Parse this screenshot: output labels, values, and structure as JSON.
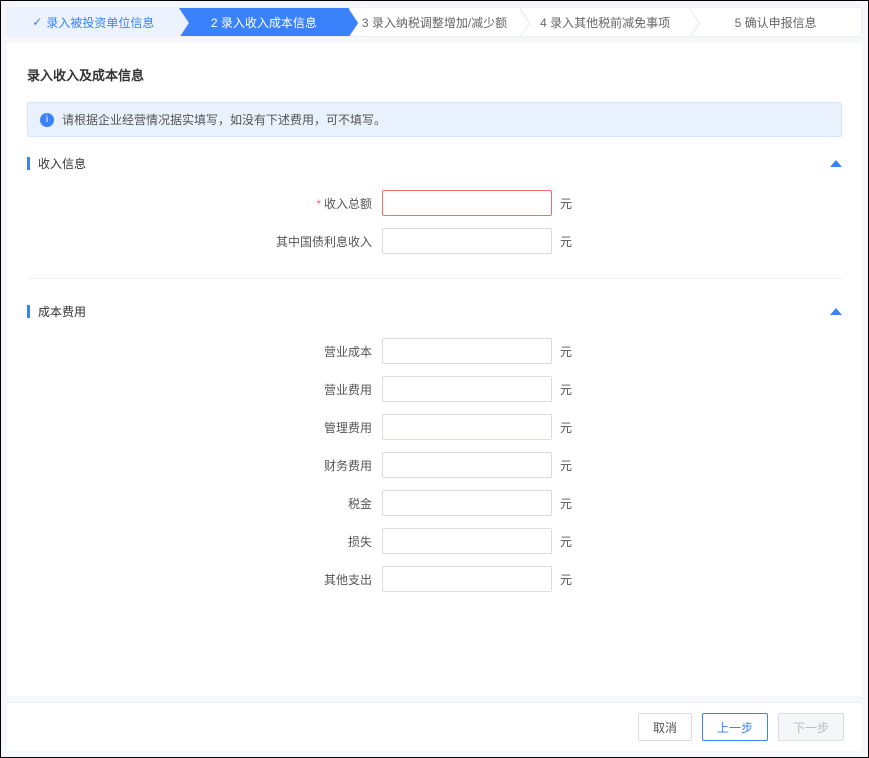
{
  "stepper": [
    {
      "label": "录入被投资单位信息",
      "state": "done"
    },
    {
      "label": "2 录入收入成本信息",
      "state": "active"
    },
    {
      "label": "3 录入纳税调整增加/减少额",
      "state": ""
    },
    {
      "label": "4 录入其他税前减免事项",
      "state": ""
    },
    {
      "label": "5 确认申报信息",
      "state": ""
    }
  ],
  "page": {
    "title": "录入收入及成本信息",
    "alert": "请根据企业经营情况据实填写，如没有下述费用，可不填写。"
  },
  "sections": {
    "income": {
      "title": "收入信息",
      "fields": {
        "total_income": {
          "label": "收入总额",
          "value": "",
          "required": true,
          "unit": "元"
        },
        "china_bond_interest": {
          "label": "其中国债利息收入",
          "value": "",
          "required": false,
          "unit": "元"
        }
      }
    },
    "cost": {
      "title": "成本费用",
      "fields": {
        "operating_cost": {
          "label": "营业成本",
          "value": "",
          "unit": "元"
        },
        "operating_expense": {
          "label": "营业费用",
          "value": "",
          "unit": "元"
        },
        "management_expense": {
          "label": "管理费用",
          "value": "",
          "unit": "元"
        },
        "finance_expense": {
          "label": "财务费用",
          "value": "",
          "unit": "元"
        },
        "tax": {
          "label": "税金",
          "value": "",
          "unit": "元"
        },
        "loss": {
          "label": "损失",
          "value": "",
          "unit": "元"
        },
        "other_expense": {
          "label": "其他支出",
          "value": "",
          "unit": "元"
        }
      }
    }
  },
  "footer": {
    "cancel": "取消",
    "prev": "上一步",
    "next": "下一步"
  }
}
